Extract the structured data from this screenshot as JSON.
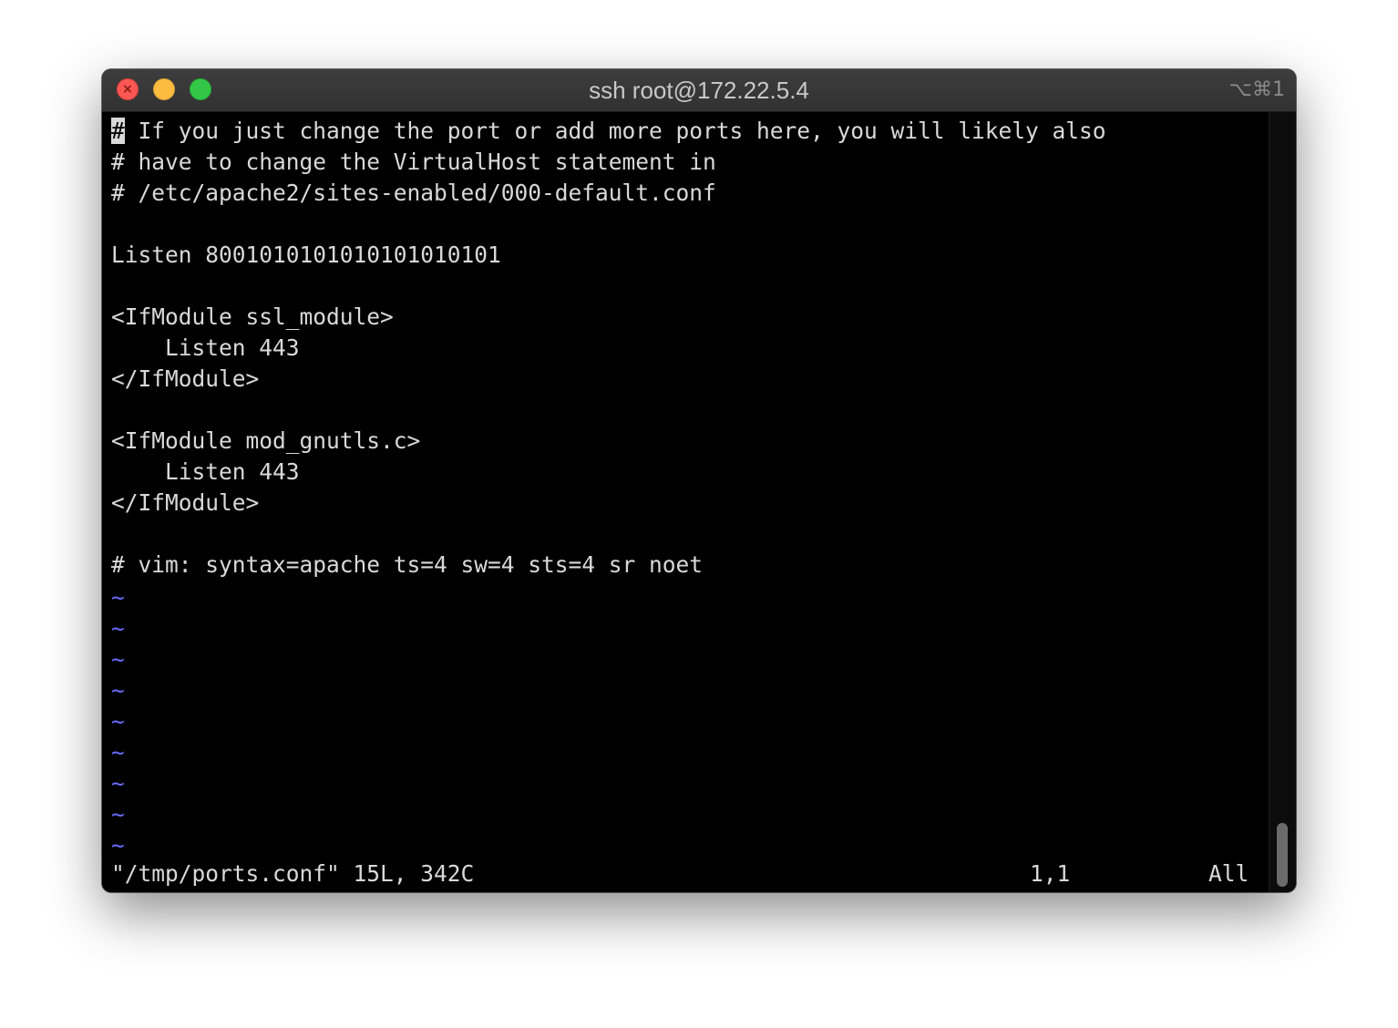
{
  "window": {
    "title": "ssh root@172.22.5.4",
    "shortcut": "⌥⌘1",
    "controls": [
      "close",
      "minimize",
      "zoom"
    ]
  },
  "editor": {
    "cursor_char": "#",
    "first_line_rest": " If you just change the port or add more ports here, you will likely also",
    "lines": [
      "# have to change the VirtualHost statement in",
      "# /etc/apache2/sites-enabled/000-default.conf",
      "",
      "Listen 8001010101010101010101",
      "",
      "<IfModule ssl_module>",
      "    Listen 443",
      "</IfModule>",
      "",
      "<IfModule mod_gnutls.c>",
      "    Listen 443",
      "</IfModule>",
      "",
      "# vim: syntax=apache ts=4 sw=4 sts=4 sr noet"
    ],
    "tilde": "~",
    "tilde_count": 9
  },
  "status": {
    "file_info": "\"/tmp/ports.conf\" 15L, 342C",
    "position": "1,1",
    "scroll": "All"
  },
  "colors": {
    "text": "#d9d9d9",
    "tilde": "#6a6cff",
    "background": "#000000"
  }
}
